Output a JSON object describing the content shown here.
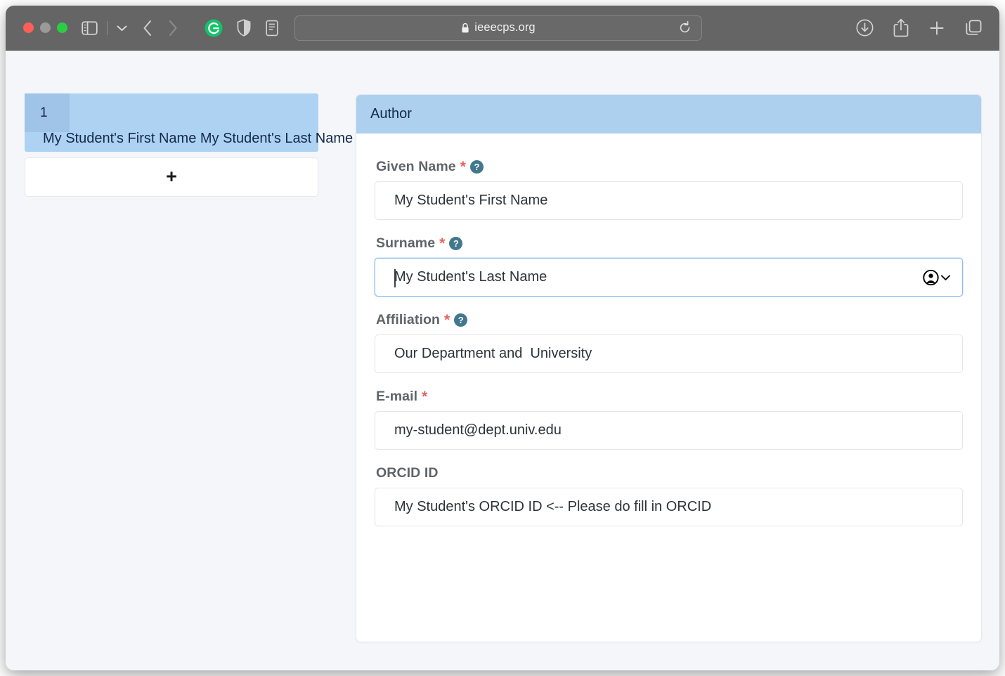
{
  "browser": {
    "url": "ieeecps.org",
    "lock_icon": "lock-icon",
    "traffic_lights": [
      "close",
      "minimize",
      "zoom"
    ],
    "toolbar_icons": [
      "sidebar-toggle-icon",
      "chevron-down-icon",
      "back-icon",
      "forward-icon",
      "grammarly-extension-icon",
      "shield-privacy-icon",
      "reader-view-icon",
      "reload-icon",
      "downloads-icon",
      "share-icon",
      "new-tab-icon",
      "tab-overview-icon"
    ]
  },
  "authors": {
    "cards": [
      {
        "number": "1",
        "name": "My Student's First Name My Student's Last Name"
      }
    ],
    "add_button_label": "+"
  },
  "panel": {
    "title": "Author",
    "fields": [
      {
        "label": "Given Name",
        "required": true,
        "has_help": true,
        "value": "My Student's First Name",
        "focused": false,
        "has_autofill": false
      },
      {
        "label": "Surname",
        "required": true,
        "has_help": true,
        "value": "My Student's Last Name",
        "focused": true,
        "has_autofill": true
      },
      {
        "label": "Affiliation",
        "required": true,
        "has_help": true,
        "value": "Our Department and  University",
        "focused": false,
        "has_autofill": false
      },
      {
        "label": "E-mail",
        "required": true,
        "has_help": false,
        "value": "my-student@dept.univ.edu",
        "focused": false,
        "has_autofill": false
      },
      {
        "label": "ORCID ID",
        "required": false,
        "has_help": false,
        "value": "My Student's ORCID ID <-- Please do fill in ORCID",
        "focused": false,
        "has_autofill": false
      }
    ],
    "required_marker": "*",
    "help_glyph": "?"
  },
  "colors": {
    "chrome": "#656565",
    "panel_header": "#aed0ef",
    "card": "#aed2f2",
    "card_badge": "#a0c4e7",
    "required": "#e8635f",
    "help": "#41788e",
    "focus_border": "#8fbcec",
    "page_bg": "#f4f6fa"
  }
}
